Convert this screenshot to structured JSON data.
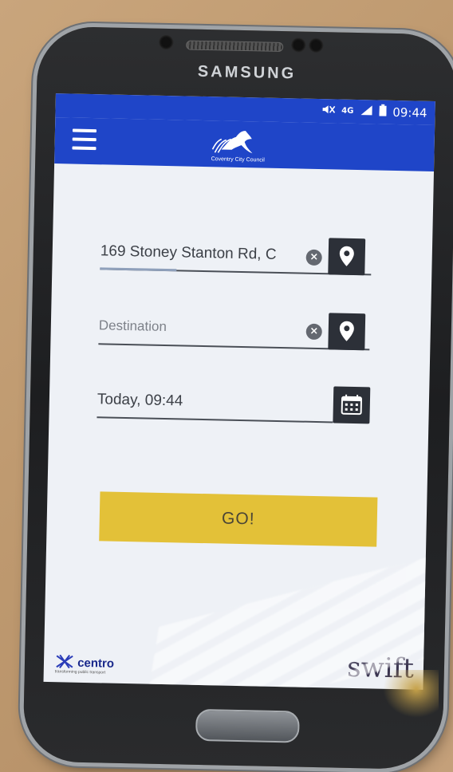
{
  "device": {
    "brand": "SAMSUNG"
  },
  "status_bar": {
    "network": "4G",
    "time": "09:44"
  },
  "app_bar": {
    "logo_text": "Coventry City Council"
  },
  "form": {
    "origin": {
      "value": "169 Stoney Stanton Rd, C"
    },
    "destination": {
      "placeholder": "Destination"
    },
    "datetime": {
      "value": "Today, 09:44"
    },
    "go_label": "GO!"
  },
  "footer": {
    "left_logo": "centro",
    "left_tagline": "transforming public transport",
    "right_logo": "swift"
  },
  "colors": {
    "app_bar": "#1f45c8",
    "go_button": "#e3c138",
    "icon_button": "#2c3038"
  }
}
